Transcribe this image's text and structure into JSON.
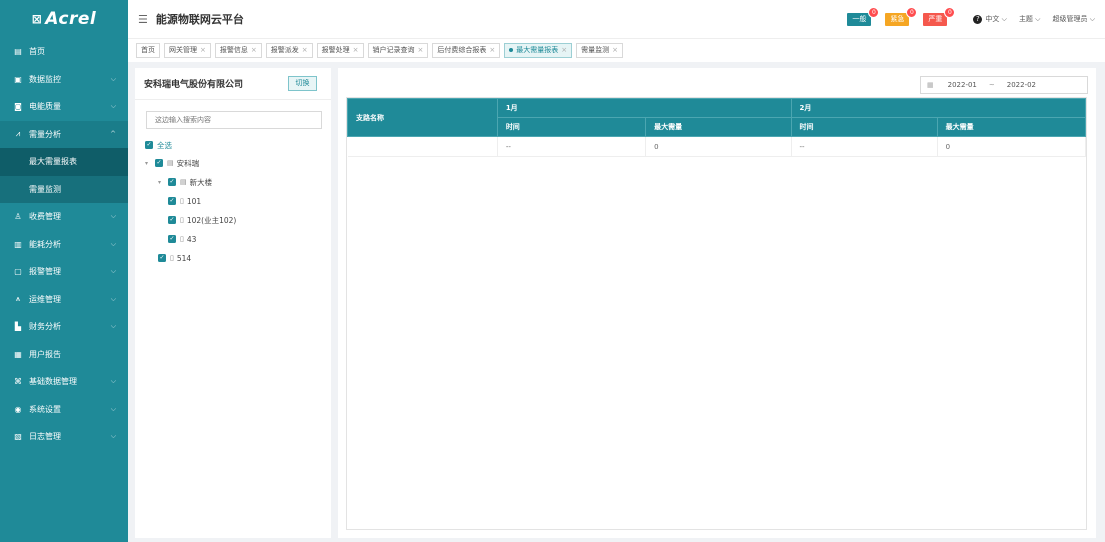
{
  "sidebar": {
    "logo_mark": "⊠",
    "logo_text": "Acrel",
    "bg_color": "#1f8a98",
    "items": [
      {
        "label": "首页",
        "icon": "home-icon",
        "glyph": "▤"
      },
      {
        "label": "数据监控",
        "icon": "monitor-icon",
        "glyph": "▣"
      },
      {
        "label": "电能质量",
        "icon": "power-quality-icon",
        "glyph": "◙"
      },
      {
        "label": "需量分析",
        "icon": "demand-icon",
        "glyph": "⩘"
      },
      {
        "label": "收费管理",
        "icon": "billing-icon",
        "glyph": "♙"
      },
      {
        "label": "能耗分析",
        "icon": "energy-icon",
        "glyph": "▥"
      },
      {
        "label": "报警管理",
        "icon": "alarm-icon",
        "glyph": "▢"
      },
      {
        "label": "运维管理",
        "icon": "maintenance-icon",
        "glyph": "⩚"
      },
      {
        "label": "财务分析",
        "icon": "finance-icon",
        "glyph": "▙"
      },
      {
        "label": "用户报告",
        "icon": "report-icon",
        "glyph": "▦"
      },
      {
        "label": "基础数据管理",
        "icon": "basedata-icon",
        "glyph": "⌘"
      },
      {
        "label": "系统设置",
        "icon": "settings-icon",
        "glyph": "◉"
      },
      {
        "label": "日志管理",
        "icon": "log-icon",
        "glyph": "▧"
      }
    ],
    "sub_items": [
      "最大需量报表",
      "需量监测"
    ]
  },
  "header": {
    "title": "能源物联网云平台",
    "alarms": [
      {
        "label": "一般",
        "count": "0",
        "color": "#1f8a98"
      },
      {
        "label": "紧急",
        "count": "0",
        "color": "#f5a623"
      },
      {
        "label": "严重",
        "count": "0",
        "color": "#f5584d"
      }
    ],
    "language": "中文",
    "theme": "主题",
    "user": "超级管理员"
  },
  "tags": [
    "首页",
    "网关管理",
    "报警信息",
    "报警派发",
    "报警处理",
    "销户记录查询",
    "后付费综合报表",
    "最大需量报表",
    "需量监测"
  ],
  "tree": {
    "company": "安科瑞电气股份有限公司",
    "switch_label": "切换",
    "search_placeholder": "这边输入搜索内容",
    "select_all": "全选",
    "nodes": {
      "root": "安科瑞",
      "building": "新大楼",
      "room101": "101",
      "room102": "102(业主102)",
      "room43": "43",
      "room514": "514"
    }
  },
  "content": {
    "range_start": "2022-01",
    "range_sep": "~",
    "range_end": "2022-02",
    "table": {
      "branch_header": "支路名称",
      "months": [
        "1月",
        "2月"
      ],
      "sub_headers": [
        "时间",
        "最大需量",
        "时间",
        "最大需量"
      ],
      "rows": [
        [
          "",
          "--",
          "0",
          "--",
          "0"
        ]
      ]
    }
  }
}
